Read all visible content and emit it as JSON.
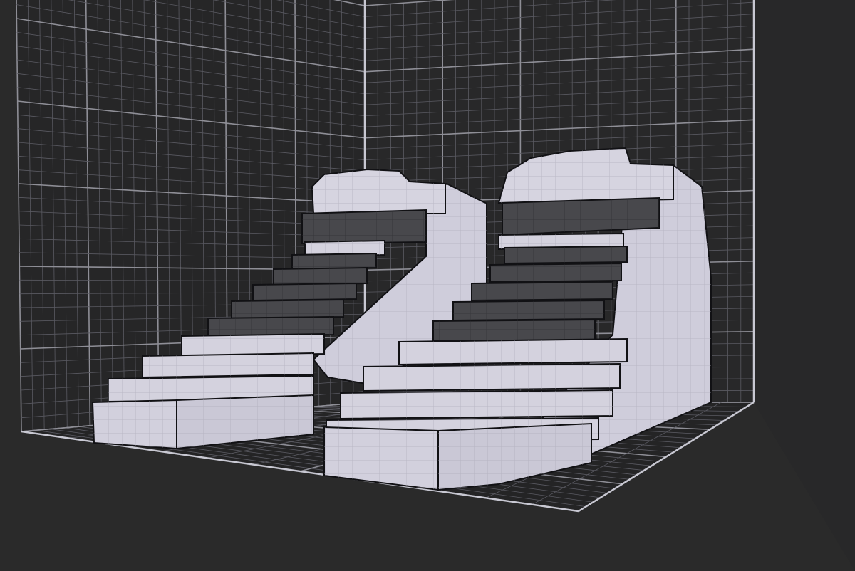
{
  "viewport": {
    "name": "voxel-3d-viewport",
    "background_color": "#2a2a2a",
    "grid_line_color": "#8e8e96",
    "grid_subline_color": "#5a5a62",
    "grid_frame_color": "#c8c8d2",
    "grid_visible": true
  },
  "model": {
    "name": "voxel-sneaker-pair",
    "shoe_count": 2,
    "voxel_light_color": "#d4d2de",
    "voxel_dark_color": "#48484c",
    "voxel_edge_color": "#111114"
  }
}
